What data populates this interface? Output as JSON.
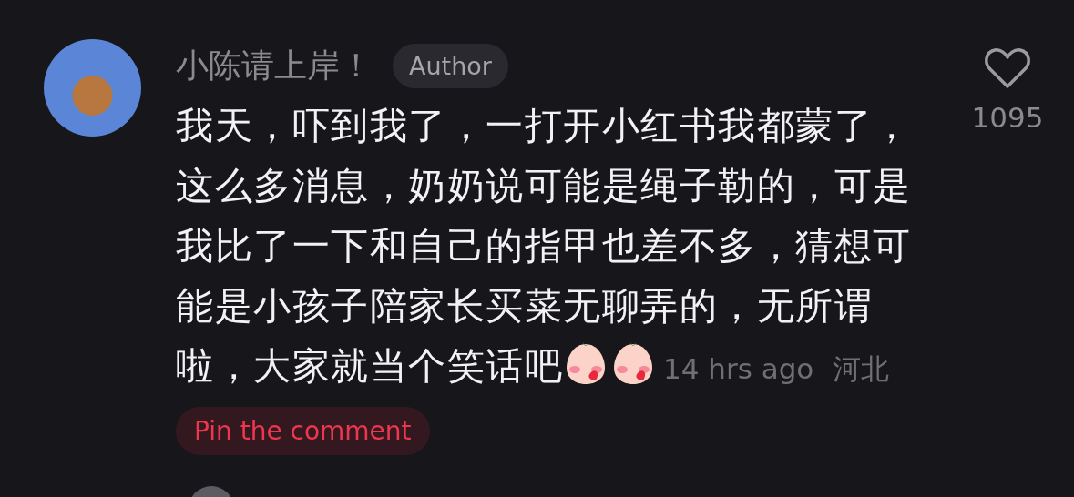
{
  "comment": {
    "author": "小陈请上岸！",
    "author_badge": "Author",
    "text_lines": [
      "我天，吓到我了，一打开小红书我都蒙了，",
      "这么多消息，奶奶说可能是绳子勒的，可是",
      "我比了一下和自己的指甲也差不多，猜想可",
      "能是小孩子陪家长买菜无聊弄的，无所谓",
      "啦，大家就当个笑话吧"
    ],
    "time": "14 hrs ago",
    "location": "河北",
    "liked": false,
    "likes": "1095",
    "pin_button": "Pin the comment"
  }
}
